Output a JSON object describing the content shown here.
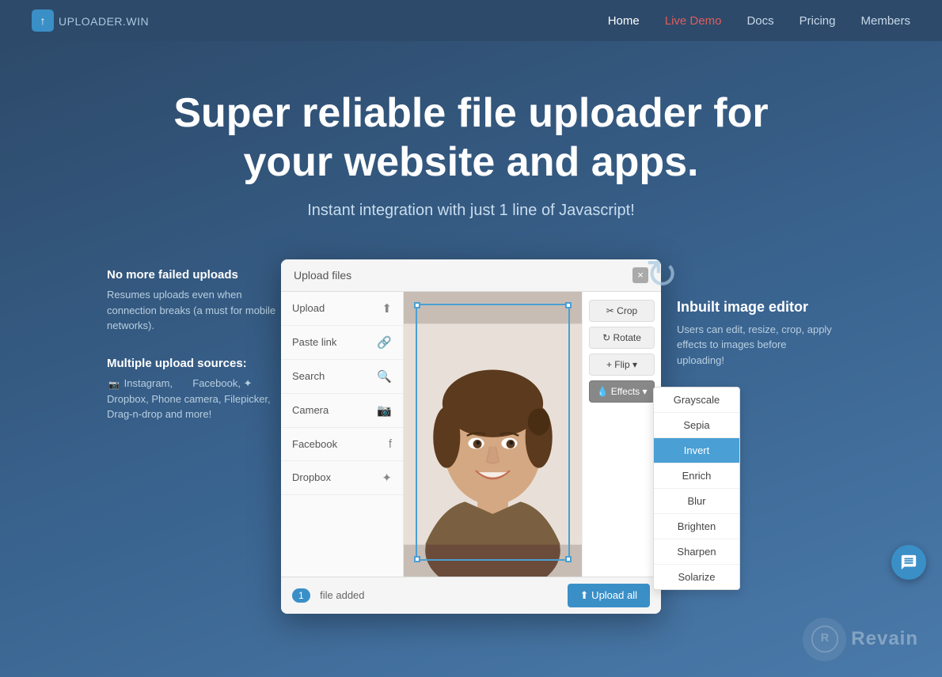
{
  "nav": {
    "logo_icon": "↑",
    "logo_brand": "UPLOADER",
    "logo_tld": ".WIN",
    "links": [
      {
        "id": "home",
        "label": "Home",
        "active": true,
        "highlight": false
      },
      {
        "id": "live-demo",
        "label": "Live Demo",
        "active": false,
        "highlight": true
      },
      {
        "id": "docs",
        "label": "Docs",
        "active": false,
        "highlight": false
      },
      {
        "id": "pricing",
        "label": "Pricing",
        "active": false,
        "highlight": false
      },
      {
        "id": "members",
        "label": "Members",
        "active": false,
        "highlight": false
      }
    ]
  },
  "hero": {
    "title": "Super reliable file uploader for your website and apps.",
    "subtitle": "Instant integration with just 1 line of Javascript!"
  },
  "left_features": {
    "feature1": {
      "title": "No more failed uploads",
      "text": "Resumes uploads even when connection breaks (a must for mobile networks)."
    },
    "feature2": {
      "title": "Multiple upload sources:",
      "text": " Instagram,  Facebook,  Dropbox, Phone camera, Filepicker, Drag-n-drop and more!"
    }
  },
  "modal": {
    "title": "Upload files",
    "close_label": "×",
    "sidebar_items": [
      {
        "id": "upload",
        "label": "Upload",
        "icon": "⬆"
      },
      {
        "id": "paste-link",
        "label": "Paste link",
        "icon": "🔗"
      },
      {
        "id": "search",
        "label": "Search",
        "icon": "🔍"
      },
      {
        "id": "camera",
        "label": "Camera",
        "icon": "📷"
      },
      {
        "id": "facebook",
        "label": "Facebook",
        "icon": "f"
      },
      {
        "id": "dropbox",
        "label": "Dropbox",
        "icon": "✦"
      }
    ],
    "toolbar_buttons": [
      {
        "id": "crop",
        "label": "✂ Crop"
      },
      {
        "id": "rotate",
        "label": "↻ Rotate"
      },
      {
        "id": "flip",
        "label": "+ Flip ▾"
      },
      {
        "id": "effects",
        "label": "💧 Effects ▾",
        "active": true
      }
    ],
    "effects_items": [
      {
        "id": "grayscale",
        "label": "Grayscale",
        "active": false
      },
      {
        "id": "sepia",
        "label": "Sepia",
        "active": false
      },
      {
        "id": "invert",
        "label": "Invert",
        "active": true
      },
      {
        "id": "enrich",
        "label": "Enrich",
        "active": false
      },
      {
        "id": "blur",
        "label": "Blur",
        "active": false
      },
      {
        "id": "brighten",
        "label": "Brighten",
        "active": false
      },
      {
        "id": "sharpen",
        "label": "Sharpen",
        "active": false
      },
      {
        "id": "solarize",
        "label": "Solarize",
        "active": false
      }
    ],
    "footer": {
      "file_count": "1",
      "file_added_text": "file added",
      "upload_btn_label": "⬆ Upload all"
    }
  },
  "right_feature": {
    "title": "Inbuilt image editor",
    "text": "Users can edit, resize, crop, apply effects to images before uploading!"
  },
  "revain": {
    "text": "Revain"
  },
  "chat": {
    "label": "chat"
  }
}
